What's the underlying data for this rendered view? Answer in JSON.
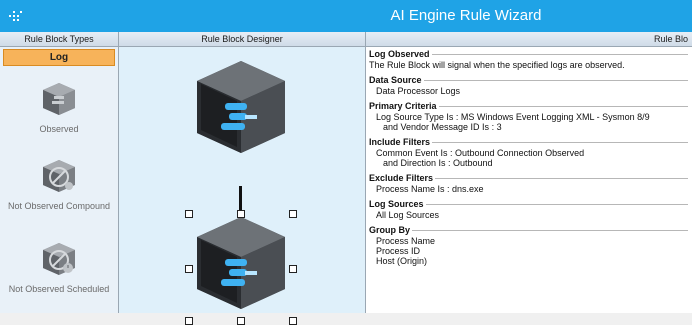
{
  "window": {
    "title": "AI Engine Rule Wizard",
    "app_icon": "grid-dots-icon",
    "accent_color": "#1fa3e6"
  },
  "block_types": {
    "header": "Rule Block Types",
    "active_tab": "Log",
    "items": [
      {
        "label": "Observed",
        "icon": "cube-observed-icon"
      },
      {
        "label": "Not Observed Compound",
        "icon": "cube-not-observed-compound-icon"
      },
      {
        "label": "Not Observed Scheduled",
        "icon": "cube-not-observed-scheduled-icon"
      }
    ]
  },
  "designer": {
    "header": "Rule Block Designer",
    "blocks": [
      {
        "icon": "rule-block-cube-icon"
      },
      {
        "icon": "rule-block-cube-icon-selected"
      }
    ]
  },
  "properties": {
    "header": "Rule Blo",
    "sections": [
      {
        "title": "Log Observed",
        "lines": [
          "The Rule Block will signal when the specified logs are observed."
        ]
      },
      {
        "title": "Data Source",
        "lines": [
          "Data Processor Logs"
        ]
      },
      {
        "title": "Primary Criteria",
        "lines": [
          "Log Source Type Is : MS Windows Event Logging XML - Sysmon 8/9",
          "and Vendor Message ID Is : 3"
        ]
      },
      {
        "title": "Include Filters",
        "lines": [
          "Common Event Is : Outbound Connection Observed",
          "and Direction Is : Outbound"
        ]
      },
      {
        "title": "Exclude Filters",
        "lines": [
          "Process Name Is : dns.exe"
        ]
      },
      {
        "title": "Log Sources",
        "lines": [
          "All Log Sources"
        ]
      },
      {
        "title": "Group By",
        "lines": [
          "Process Name",
          "Process ID",
          "Host (Origin)"
        ]
      }
    ]
  }
}
